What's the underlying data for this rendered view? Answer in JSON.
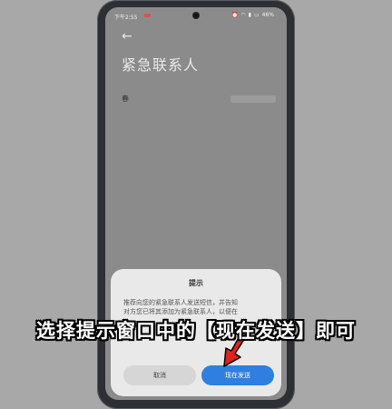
{
  "status_bar": {
    "time": "下午2:55",
    "battery": "46%",
    "icons": [
      "alarm-icon",
      "wifi-icon",
      "signal-icon",
      "battery-icon"
    ]
  },
  "page": {
    "title": "紧急联系人",
    "contact_name": "春"
  },
  "dialog": {
    "title": "提示",
    "body_line1": "推荐向您的紧急联系人发送短信，并告知",
    "body_line2": "对方您已将其添加为紧急联系人，以便在",
    "cancel_label": "取消",
    "send_label": "现在发送"
  },
  "caption": {
    "text": "选择提示窗口中的【现在发送】即可"
  },
  "colors": {
    "accent_blue": "#2f7fe0",
    "arrow_red": "#e0241b"
  }
}
